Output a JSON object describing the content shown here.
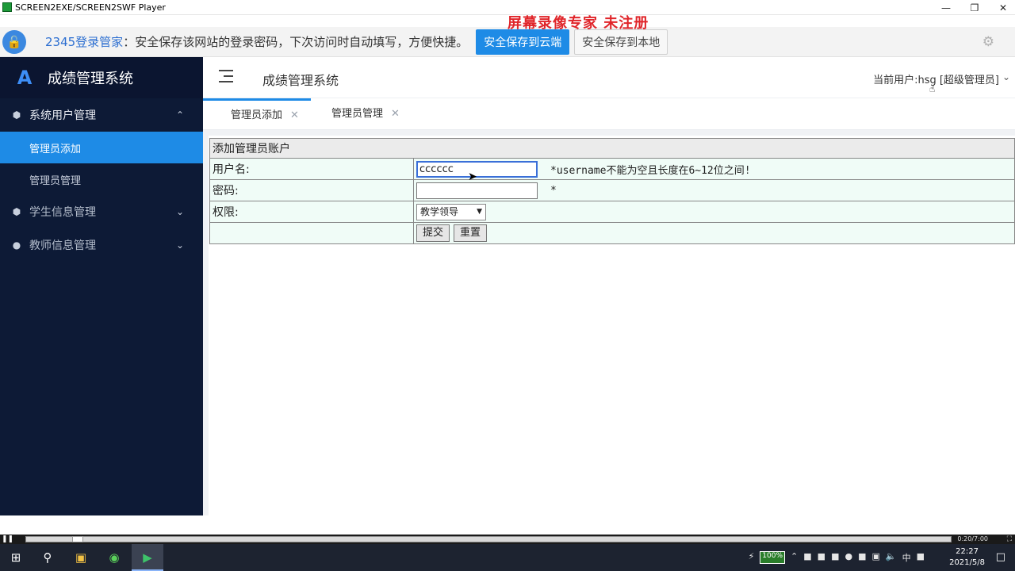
{
  "window": {
    "title": "SCREEN2EXE/SCREEN2SWF Player",
    "watermark": "屏幕录像专家  未注册"
  },
  "pwbar": {
    "brand": "2345登录管家",
    "message": "：安全保存该网站的登录密码，下次访问时自动填写，方便快捷。",
    "cloud_button": "安全保存到云端",
    "local_button": "安全保存到本地"
  },
  "sidebar": {
    "app_title": "成绩管理系统",
    "groups": [
      {
        "label": "系统用户管理",
        "items": [
          "管理员添加",
          "管理员管理"
        ]
      },
      {
        "label": "学生信息管理"
      },
      {
        "label": "教师信息管理"
      }
    ]
  },
  "header": {
    "system_name": "成绩管理系统",
    "user": "当前用户:hsg [超级管理员]"
  },
  "tabs": [
    {
      "label": "管理员添加"
    },
    {
      "label": "管理员管理"
    }
  ],
  "form": {
    "title": "添加管理员账户",
    "username_label": "用户名:",
    "username_value": "cccccc",
    "username_hint": "*username不能为空且长度在6~12位之间!",
    "password_label": "密码:",
    "password_hint": "*",
    "role_label": "权限:",
    "role_selected": "教学领导",
    "submit_label": "提交",
    "reset_label": "重置"
  },
  "player": {
    "time": "0:20/7:00"
  },
  "taskbar": {
    "battery": "100%",
    "ime": "中",
    "time": "22:27",
    "date": "2021/5/8"
  },
  "colors": {
    "accent": "#1e8be6",
    "sidebar_bg": "#0d1a36",
    "form_bg": "#f0fcf7",
    "watermark": "#e0252a"
  }
}
